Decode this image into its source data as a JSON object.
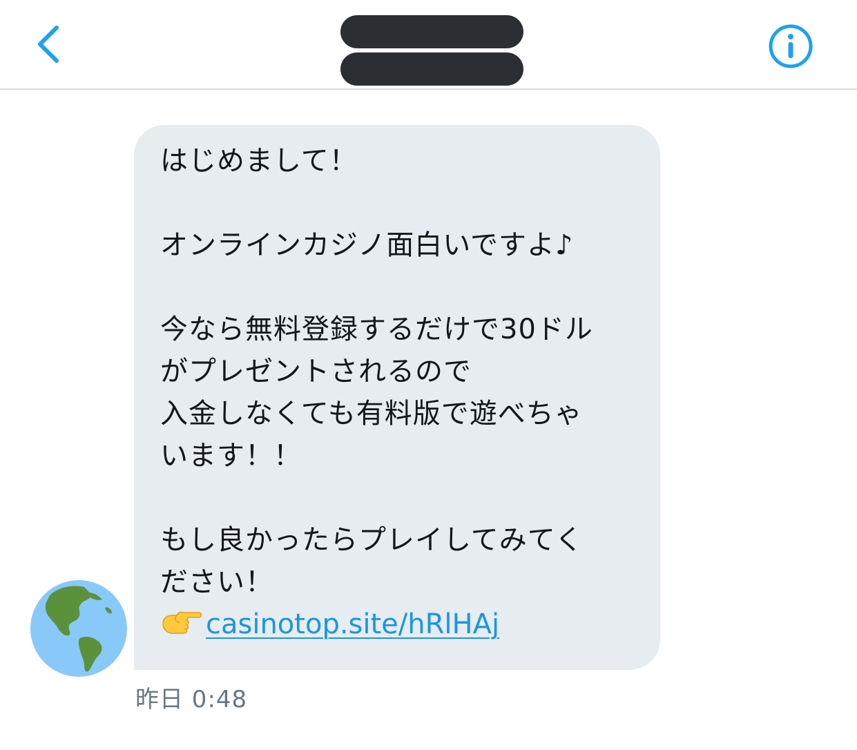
{
  "header": {
    "back_icon": "chevron-left-icon",
    "info_icon": "info-circle-icon",
    "accent_color": "#1da1f2",
    "redaction_color": "#2b2f33"
  },
  "conversation": {
    "avatar_icon": "globe-americas-icon",
    "message": {
      "lines": [
        "はじめまして！",
        "",
        "オンラインカジノ面白いですよ♪",
        "",
        "今なら無料登録するだけで30ドル",
        "がプレゼントされるので",
        "入金しなくても有料版で遊べちゃ",
        "います！！",
        "",
        "もし良かったらプレイしてみてく",
        "ださい！"
      ],
      "link_emoji": "pointing-right-hand-icon",
      "link_text": "casinotop.site/hRlHAj",
      "bubble_color": "#e6ecf0",
      "link_color": "#1b95e0"
    },
    "timestamp": "昨日 0:48"
  }
}
